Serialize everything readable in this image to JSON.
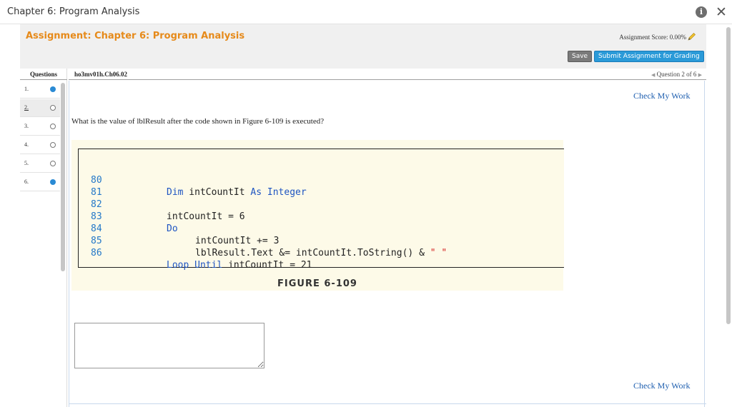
{
  "window": {
    "title": "Chapter 6: Program Analysis"
  },
  "header": {
    "assignment_title": "Assignment: Chapter 6: Program Analysis",
    "score_text": "Assignment Score: 0.00%",
    "save_label": "Save",
    "submit_label": "Submit Assignment for Grading"
  },
  "sidebar": {
    "heading": "Questions",
    "items": [
      {
        "num": "1.",
        "status": "answered"
      },
      {
        "num": "2.",
        "status": "unanswered"
      },
      {
        "num": "3.",
        "status": "unanswered"
      },
      {
        "num": "4.",
        "status": "unanswered"
      },
      {
        "num": "5.",
        "status": "unanswered"
      },
      {
        "num": "6.",
        "status": "answered"
      }
    ]
  },
  "question": {
    "id": "ho3mv01h.Ch06.02",
    "nav_text": "Question 2 of 6",
    "check_label": "Check My Work",
    "prompt": "What is the value of lblResult after the code shown in Figure 6-109 is executed?",
    "figure_caption": "FIGURE 6-109",
    "answer_value": ""
  },
  "code": {
    "lines": [
      {
        "num": "80",
        "t1": "Dim",
        "t2": " intCountIt ",
        "t3": "As",
        "t4": " ",
        "t5": "Integer"
      },
      {
        "num": "81"
      },
      {
        "num": "82",
        "text": "intCountIt = 6"
      },
      {
        "num": "83",
        "kw": "Do"
      },
      {
        "num": "84",
        "text": "intCountIt += 3"
      },
      {
        "num": "85",
        "a": "lblResult.Text &= intCountIt.ToString() & ",
        "s": "\" \""
      },
      {
        "num": "86",
        "k1": "Loop",
        "m1": " ",
        "k2": "Until",
        "r": " intCountIt = 21"
      }
    ]
  },
  "colors": {
    "accent_orange": "#e68a1a",
    "link_blue": "#2060b0",
    "submit_blue": "#2a9ad8",
    "keyword_blue": "#1f55c2",
    "string_red": "#d42020",
    "figure_bg": "#fdfae8"
  },
  "icons": {
    "info": "info-icon",
    "close": "close-icon",
    "pencil": "pencil-icon",
    "prev": "chevron-left-icon",
    "next": "chevron-right-icon"
  }
}
